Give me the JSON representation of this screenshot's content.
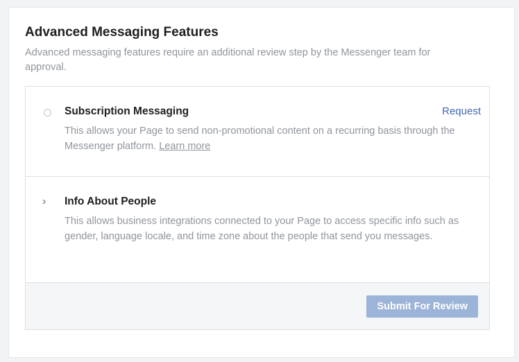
{
  "section": {
    "title": "Advanced Messaging Features",
    "description": "Advanced messaging features require an additional review step by the Messenger team for approval."
  },
  "features": [
    {
      "title": "Subscription Messaging",
      "description": "This allows your Page to send non-promotional content on a recurring basis through the Messenger platform.",
      "learn_more": "Learn more",
      "action_label": "Request",
      "control": "radio-icon",
      "selected": false
    },
    {
      "title": "Info About People",
      "description": "This allows business integrations connected to your Page to access specific info such as gender, language locale, and time zone about the people that send you messages.",
      "control": "chevron-right-icon",
      "expanded": false
    }
  ],
  "footer": {
    "submit_label": "Submit For Review",
    "submit_enabled": false
  },
  "colors": {
    "link": "#4267b2",
    "button_disabled": "#9cb4d8",
    "text_primary": "#1c1e21",
    "text_secondary": "#90949c"
  }
}
